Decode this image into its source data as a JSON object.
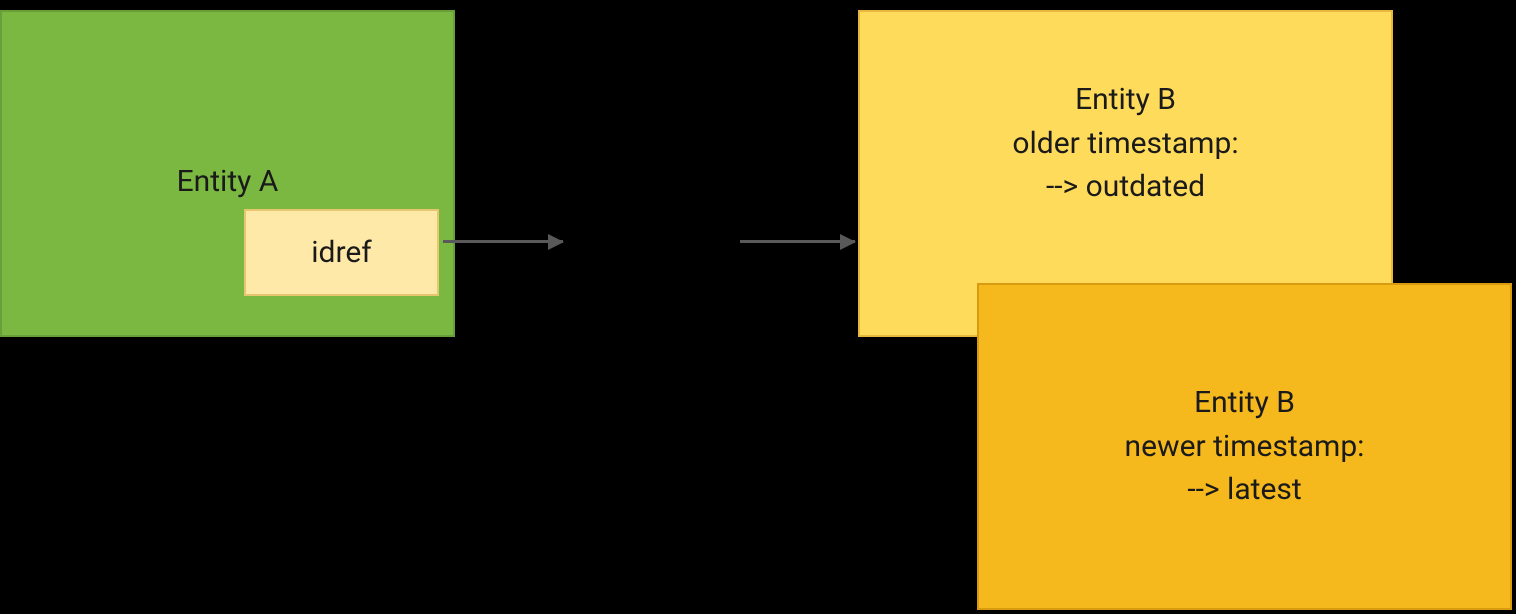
{
  "entityA": {
    "label": "Entity A",
    "idref": "idref"
  },
  "entityB": {
    "old": {
      "line1": "Entity B",
      "line2": "older timestamp:",
      "line3": "--> outdated"
    },
    "new": {
      "line1": "Entity B",
      "line2": "newer timestamp:",
      "line3": "--> latest"
    }
  },
  "colors": {
    "entityA_bg": "#7BB842",
    "entityA_border": "#689F38",
    "idref_bg": "#FFE9A8",
    "idref_border": "#E6C770",
    "entityB_old_bg": "#FFDB5C",
    "entityB_old_border": "#E6B83F",
    "entityB_new_bg": "#F5B91E",
    "entityB_new_border": "#D99A0F",
    "arrow": "#595959"
  }
}
